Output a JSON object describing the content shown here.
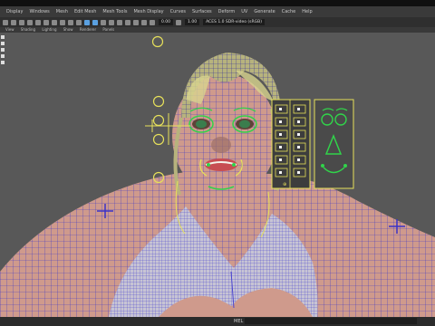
{
  "menubar": {
    "items": [
      "Display",
      "Windows",
      "Mesh",
      "Edit Mesh",
      "Mesh Tools",
      "Mesh Display",
      "Curves",
      "Surfaces",
      "Deform",
      "UV",
      "Generate",
      "Cache",
      "Help"
    ]
  },
  "toolbar": {
    "field_1": "0.00",
    "field_2": "1.00",
    "color_space": "ACES 1.0 SDR-video (sRGB)"
  },
  "panel_menu": [
    "View",
    "Shading",
    "Lighting",
    "Show",
    "Renderer",
    "Panels"
  ],
  "status_bar": {
    "mel_label": "MEL"
  },
  "colors": {
    "viewport_bg": "#585858",
    "skin": "#cf9a8c",
    "wire": "#3a33c8",
    "control_yellow": "#e6e05a",
    "control_green": "#31d34a"
  }
}
